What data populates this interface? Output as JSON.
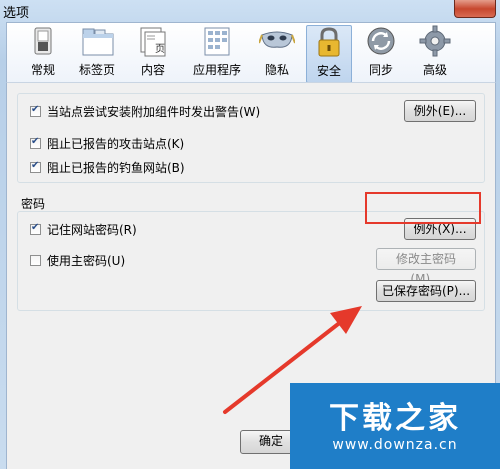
{
  "window": {
    "title": "选项"
  },
  "toolbar": {
    "panes": [
      {
        "label": "常规",
        "icon": "switch-icon"
      },
      {
        "label": "标签页",
        "icon": "tabs-icon"
      },
      {
        "label": "内容",
        "icon": "page-icon"
      },
      {
        "label": "应用程序",
        "icon": "apps-icon"
      },
      {
        "label": "隐私",
        "icon": "mask-icon"
      },
      {
        "label": "安全",
        "icon": "padlock-icon",
        "active": true
      },
      {
        "label": "同步",
        "icon": "sync-icon"
      },
      {
        "label": "高级",
        "icon": "gear-icon"
      }
    ],
    "content_icon_text": "页"
  },
  "security": {
    "warn_addons": {
      "label": "当站点尝试安装附加组件时发出警告(W)",
      "checked": true
    },
    "block_attack": {
      "label": "阻止已报告的攻击站点(K)",
      "checked": true
    },
    "block_forgery": {
      "label": "阻止已报告的钓鱼网站(B)",
      "checked": true
    },
    "exceptions_button": "例外(E)..."
  },
  "passwords": {
    "legend": "密码",
    "remember": {
      "label": "记住网站密码(R)",
      "checked": true
    },
    "master": {
      "label": "使用主密码(U)",
      "checked": false
    },
    "exceptions_button": "例外(X)...",
    "change_master_button": "修改主密码(M)...",
    "saved_button": "已保存密码(P)..."
  },
  "footer": {
    "ok_button": "确定"
  },
  "watermark": {
    "title": "下载之家",
    "url": "www.downza.cn"
  },
  "colors": {
    "accent": "#e5392b",
    "watermark_bg": "#1f7ec8"
  }
}
